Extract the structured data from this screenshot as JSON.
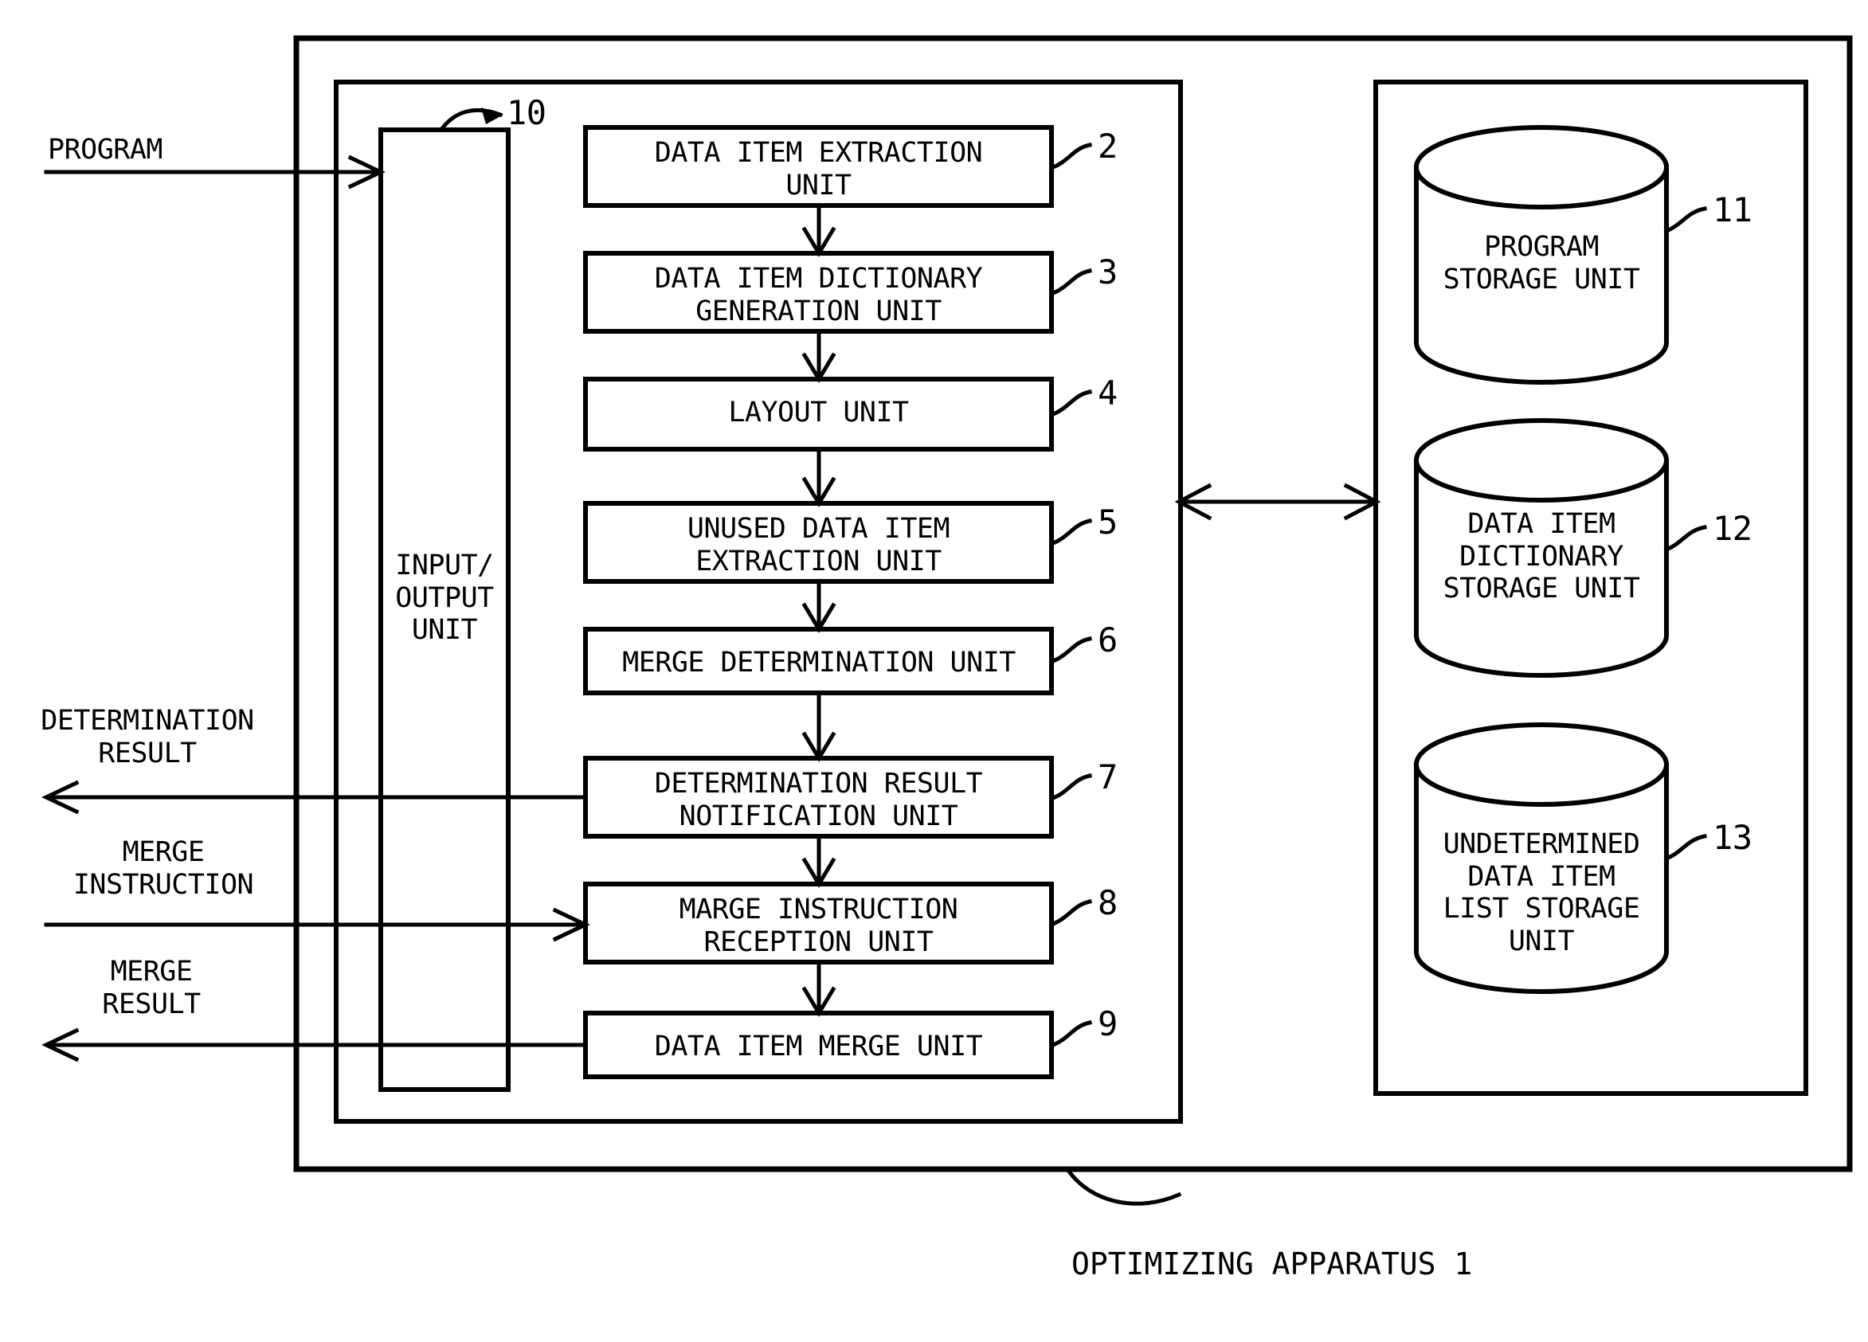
{
  "figure": {
    "caption": "OPTIMIZING APPARATUS 1",
    "io_unit": {
      "label": "INPUT/\nOUTPUT\nUNIT",
      "ref": "10"
    },
    "external_labels": [
      {
        "name": "program-label",
        "text": "PROGRAM",
        "direction": "in"
      },
      {
        "name": "determination-result-label",
        "text": "DETERMINATION\nRESULT",
        "direction": "out"
      },
      {
        "name": "merge-instruction-label",
        "text": "MERGE\nINSTRUCTION",
        "direction": "in"
      },
      {
        "name": "merge-result-label",
        "text": "MERGE\nRESULT",
        "direction": "out"
      }
    ],
    "process_units": [
      {
        "ref": "2",
        "label": "DATA ITEM EXTRACTION\nUNIT"
      },
      {
        "ref": "3",
        "label": "DATA ITEM DICTIONARY\nGENERATION UNIT"
      },
      {
        "ref": "4",
        "label": "LAYOUT UNIT"
      },
      {
        "ref": "5",
        "label": "UNUSED DATA ITEM\nEXTRACTION UNIT"
      },
      {
        "ref": "6",
        "label": "MERGE DETERMINATION UNIT"
      },
      {
        "ref": "7",
        "label": "DETERMINATION RESULT\nNOTIFICATION UNIT"
      },
      {
        "ref": "8",
        "label": "MARGE INSTRUCTION\nRECEPTION UNIT"
      },
      {
        "ref": "9",
        "label": "DATA ITEM MERGE UNIT"
      }
    ],
    "storage_units": [
      {
        "ref": "11",
        "label": "PROGRAM\nSTORAGE UNIT"
      },
      {
        "ref": "12",
        "label": "DATA ITEM\nDICTIONARY\nSTORAGE UNIT"
      },
      {
        "ref": "13",
        "label": "UNDETERMINED\nDATA ITEM\nLIST STORAGE\nUNIT"
      }
    ],
    "colors": {
      "ink": "#000000",
      "paper": "#ffffff"
    }
  }
}
